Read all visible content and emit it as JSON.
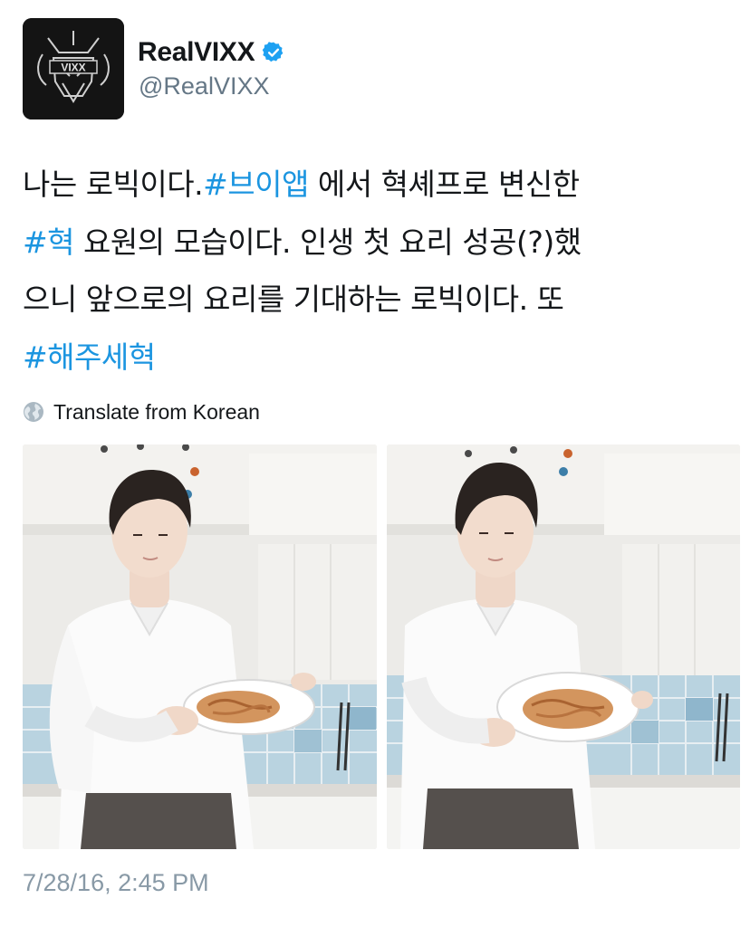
{
  "tweet": {
    "author": {
      "display_name": "RealVIXX",
      "handle": "@RealVIXX",
      "verified": true,
      "avatar_icon": "vixx-logo-icon",
      "avatar_text": "VIXX"
    },
    "text_lines": [
      [
        {
          "text": "나는 로빅이다.",
          "type": "text"
        },
        {
          "text": "#브이앱",
          "type": "hashtag"
        },
        {
          "text": " 에서 혁셰프로 변신한",
          "type": "text"
        }
      ],
      [
        {
          "text": "#혁",
          "type": "hashtag"
        },
        {
          "text": " 요원의 모습이다. 인생 첫 요리 성공(?)했",
          "type": "text"
        }
      ],
      [
        {
          "text": "으니 앞으로의 요리를 기대하는 로빅이다. 또",
          "type": "text"
        }
      ],
      [
        {
          "text": "#해주세혁",
          "type": "hashtag"
        }
      ]
    ],
    "translate": {
      "icon": "globe-icon",
      "label": "Translate from Korean"
    },
    "media": [
      {
        "kind": "photo",
        "subject": "person holding plate of pasta in kitchen"
      },
      {
        "kind": "photo",
        "subject": "person holding plate of pasta in kitchen"
      }
    ],
    "timestamp": "7/28/16, 2:45 PM",
    "colors": {
      "hashtag": "#1b95e0",
      "verified_badge": "#1da1f2",
      "secondary_text": "#657786",
      "timestamp": "#8899a6",
      "primary_text": "#14171a"
    }
  }
}
